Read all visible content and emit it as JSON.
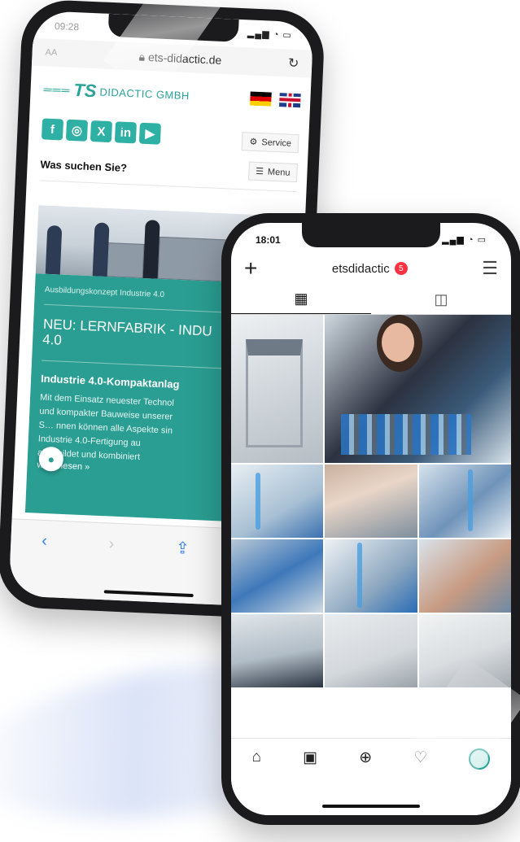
{
  "browser_phone": {
    "status_time": "09:28",
    "status_signals": "▂▄▆ ◔ ▭",
    "address_bar": {
      "text_size": "AA",
      "url": "ets-didactic.de",
      "reload_icon": "reload-icon"
    },
    "logo": {
      "lines": "═══",
      "ts": "TS",
      "company": "DIDACTIC GMBH"
    },
    "service_label": "Service",
    "menu_label": "Menu",
    "social_icons": [
      "f",
      "◎",
      "X",
      "in",
      "▶"
    ],
    "search": {
      "label": "Was suchen Sie?",
      "icon": "search-icon"
    },
    "panel": {
      "crumb": "Ausbildungskonzept Industrie 4.0",
      "headline": "NEU: LERNFABRIK - INDU\n4.0",
      "sub": "Industrie 4.0-Kompaktanlag",
      "body": "Mit dem Einsatz neuester Technol\nund kompakter Bauweise unserer\nS… nnen können alle Aspekte sin\nIndustrie 4.0-Fertigung au\nabgebildet und kombiniert",
      "more": "weiterlesen »"
    },
    "toolbar": {
      "back": "‹",
      "forward": "›",
      "share": "⇪",
      "bookmarks": "▯"
    }
  },
  "instagram_phone": {
    "status_time": "18:01",
    "status_signals": "▂▄▆ ◔ ▭",
    "header": {
      "plus": "+",
      "username": "etsdidactic",
      "badge": "5",
      "menu": "☰"
    },
    "tabs": {
      "grid_icon": "▦",
      "tagged_icon": "◫"
    },
    "bottom_nav": {
      "home": "⌂",
      "reels": "▣",
      "add": "⊕",
      "likes": "♡"
    }
  },
  "colors": {
    "brand_teal": "#2a9e92",
    "link_blue": "#2f7df6",
    "badge_red": "#ff3041"
  }
}
